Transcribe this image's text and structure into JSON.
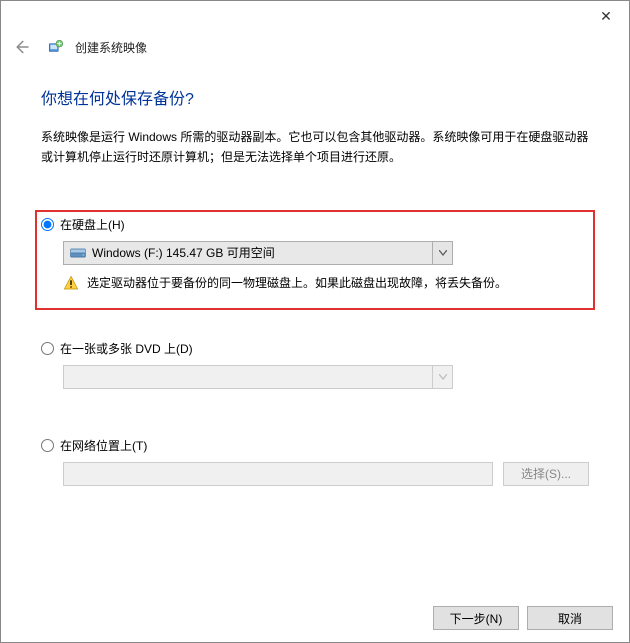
{
  "window": {
    "wizard_title": "创建系统映像"
  },
  "heading": "你想在何处保存备份?",
  "description": "系统映像是运行 Windows 所需的驱动器副本。它也可以包含其他驱动器。系统映像可用于在硬盘驱动器或计算机停止运行时还原计算机；但是无法选择单个项目进行还原。",
  "options": {
    "hard_disk": {
      "label": "在硬盘上(H)",
      "drive_text": "Windows (F:)  145.47 GB 可用空间",
      "warning": "选定驱动器位于要备份的同一物理磁盘上。如果此磁盘出现故障，将丢失备份。"
    },
    "dvd": {
      "label": "在一张或多张 DVD 上(D)"
    },
    "network": {
      "label": "在网络位置上(T)",
      "browse": "选择(S)..."
    }
  },
  "buttons": {
    "next": "下一步(N)",
    "cancel": "取消"
  }
}
